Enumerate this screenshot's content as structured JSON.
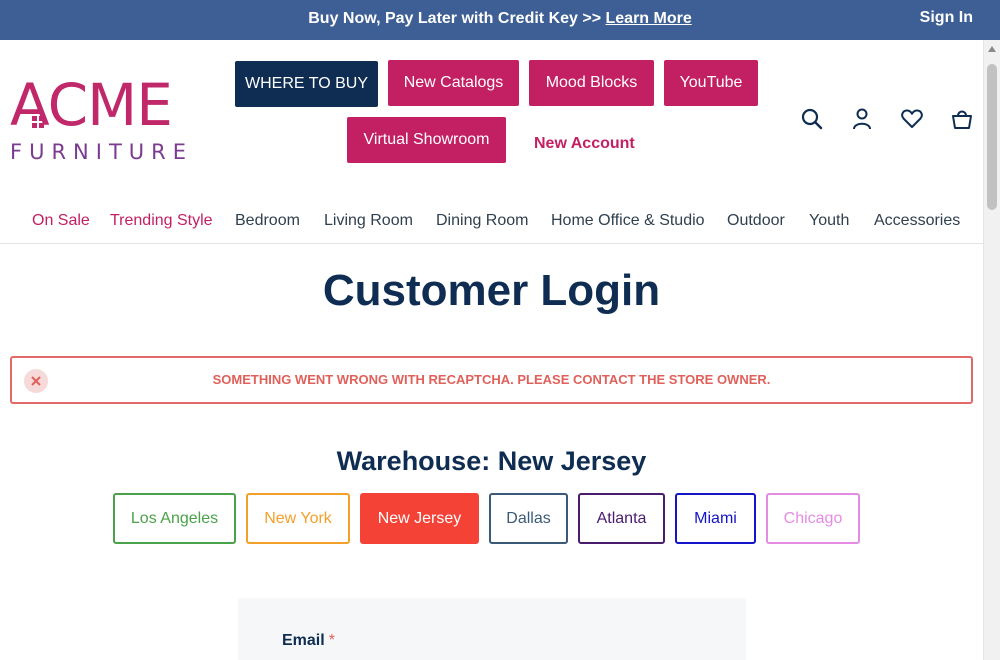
{
  "promo": {
    "text": "Buy Now, Pay Later with Credit Key >> ",
    "link": "Learn More",
    "sign_in": "Sign In"
  },
  "logo": {
    "top": "ACME",
    "bottom": "FURNITURE"
  },
  "header_buttons": {
    "where_to_buy": "WHERE TO BUY",
    "new_catalogs": "New Catalogs",
    "mood_blocks": "Mood Blocks",
    "youtube": "YouTube",
    "virtual_showroom": "Virtual Showroom",
    "new_account": "New Account"
  },
  "header_icons": [
    "search-icon",
    "account-icon",
    "heart-icon",
    "bag-icon"
  ],
  "nav": [
    "On Sale",
    "Trending Style",
    "Bedroom",
    "Living Room",
    "Dining Room",
    "Home Office & Studio",
    "Outdoor",
    "Youth",
    "Accessories"
  ],
  "page_title": "Customer Login",
  "error": {
    "message": "SOMETHING WENT WRONG WITH RECAPTCHA. PLEASE CONTACT THE STORE OWNER."
  },
  "warehouse": {
    "title": "Warehouse: New Jersey",
    "options": [
      "Los Angeles",
      "New York",
      "New Jersey",
      "Dallas",
      "Atlanta",
      "Miami",
      "Chicago"
    ],
    "selected": "New Jersey"
  },
  "form": {
    "email_label": "Email",
    "required_mark": "*"
  },
  "colors": {
    "promo_bar": "#3d5f95",
    "navy": "#0f2d52",
    "brand_pink": "#c31f63",
    "error": "#e0605a",
    "los_angeles": "#4aa24a",
    "new_york": "#f3a02a",
    "new_jersey": "#f44336",
    "dallas": "#3b5a77",
    "atlanta": "#4b1b6e",
    "miami": "#1414c8",
    "chicago": "#e48ce4"
  }
}
